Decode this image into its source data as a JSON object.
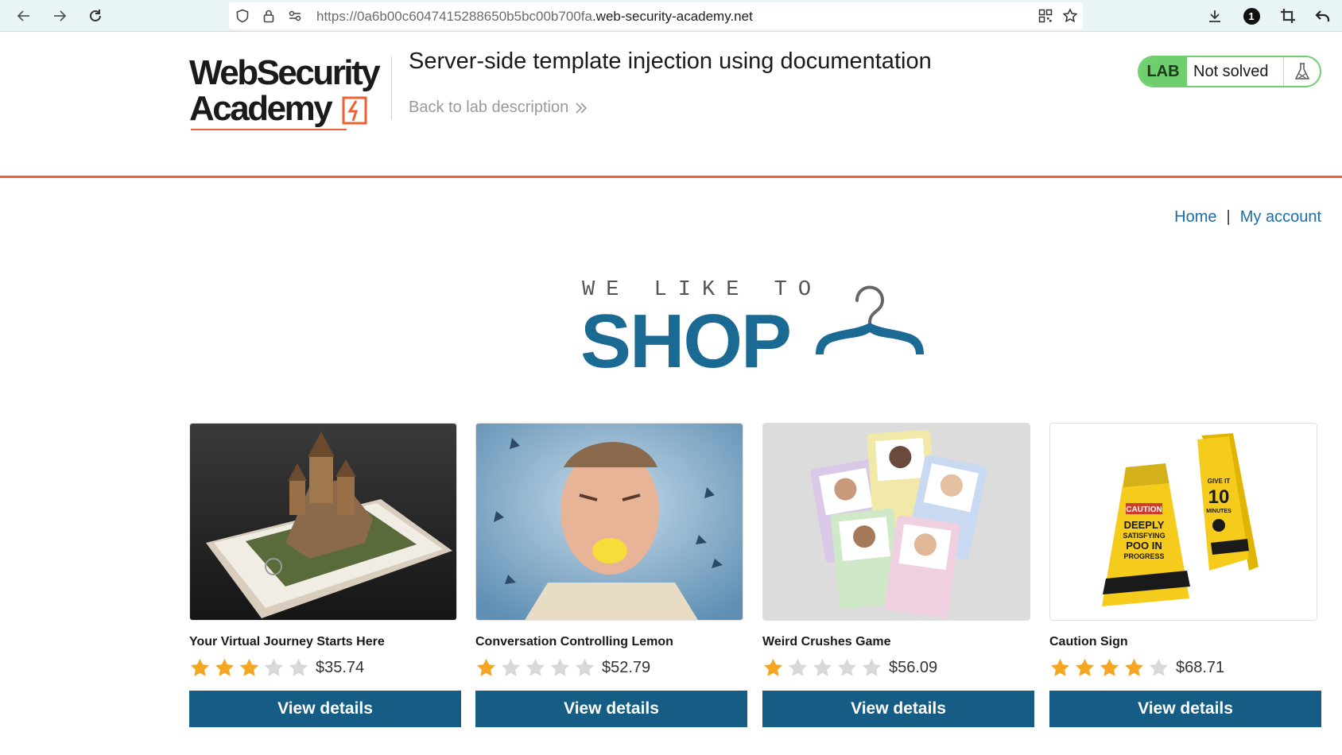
{
  "browser": {
    "url_prefix": "https://0a6b00c6047415288650b5bc00b700fa",
    "url_domain": ".web-security-academy.net",
    "notification_count": "1"
  },
  "lab": {
    "logo_line1": "WebSecurity",
    "logo_line2": "Academy",
    "title": "Server-side template injection using documentation",
    "back_link": "Back to lab description",
    "badge": "LAB",
    "status": "Not solved",
    "status_color": "#6fcf6f",
    "accent_color": "#ee6132"
  },
  "nav": {
    "home": "Home",
    "separator": "|",
    "account": "My account"
  },
  "banner": {
    "tagline": "WE LIKE TO",
    "headline": "SHOP",
    "icon": "hanger-icon",
    "color": "#1b6a93"
  },
  "products": [
    {
      "name": "Your Virtual Journey Starts Here",
      "rating": 3,
      "price": "$35.74",
      "button": "View details",
      "image": "phone-castle-image"
    },
    {
      "name": "Conversation Controlling Lemon",
      "rating": 1,
      "price": "$52.79",
      "button": "View details",
      "image": "lemon-face-image"
    },
    {
      "name": "Weird Crushes Game",
      "rating": 1,
      "price": "$56.09",
      "button": "View details",
      "image": "playing-cards-image"
    },
    {
      "name": "Caution Sign",
      "rating": 4,
      "price": "$68.71",
      "button": "View details",
      "image": "caution-sign-image"
    }
  ],
  "caution_sign": {
    "front_top": "CAUTION",
    "front_lines": [
      "DEEPLY",
      "SATISFYING",
      "POO IN",
      "PROGRESS"
    ],
    "back_lines": [
      "GIVE IT",
      "10",
      "MINUTES"
    ]
  },
  "colors": {
    "star_filled": "#f5a623",
    "star_empty": "#d8d8d8",
    "button_bg": "#155d85",
    "link": "#1a6dab"
  }
}
